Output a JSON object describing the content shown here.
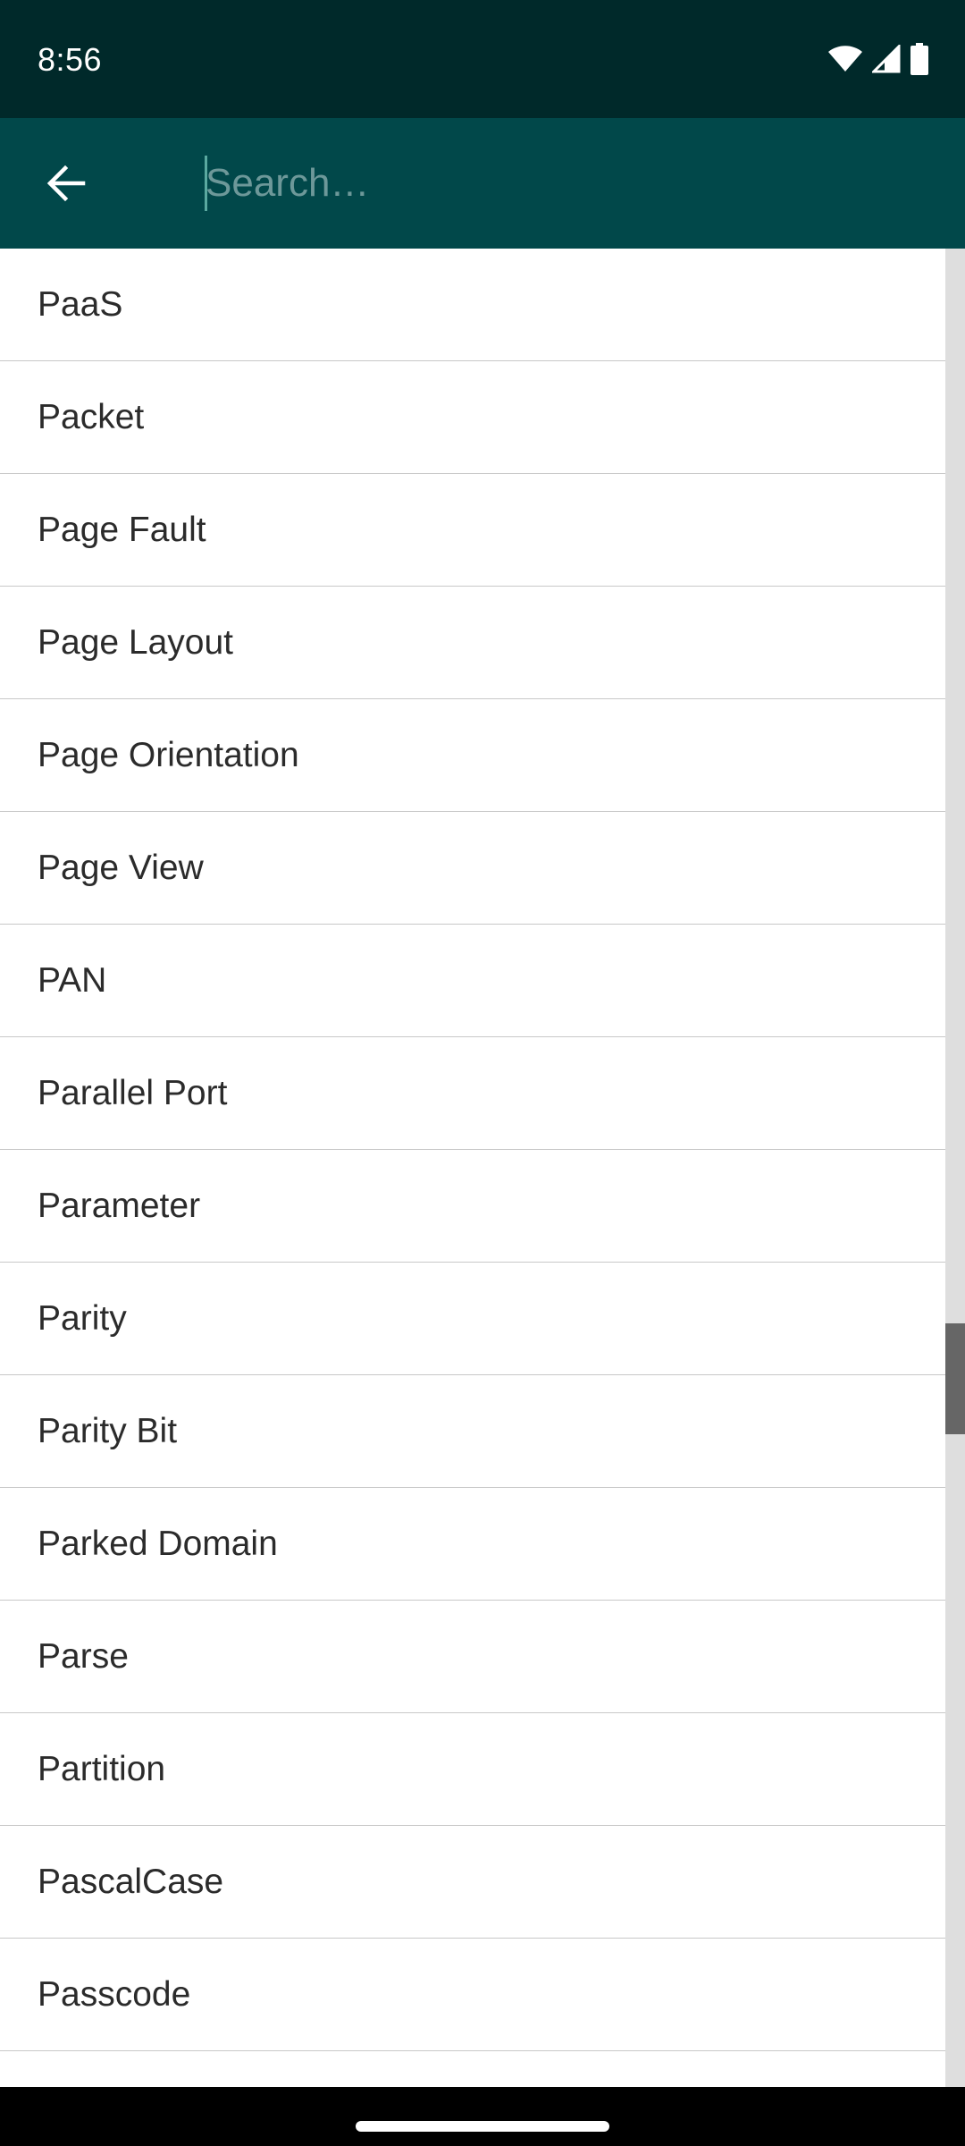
{
  "status_bar": {
    "time": "8:56",
    "icons": [
      "wifi-icon",
      "signal-icon",
      "battery-icon"
    ]
  },
  "app_bar": {
    "back_icon": "arrow-left-icon",
    "search": {
      "value": "",
      "placeholder": "Search…"
    }
  },
  "list": {
    "items": [
      {
        "label": "PaaS"
      },
      {
        "label": "Packet"
      },
      {
        "label": "Page Fault"
      },
      {
        "label": "Page Layout"
      },
      {
        "label": "Page Orientation"
      },
      {
        "label": "Page View"
      },
      {
        "label": "PAN"
      },
      {
        "label": "Parallel Port"
      },
      {
        "label": "Parameter"
      },
      {
        "label": "Parity"
      },
      {
        "label": "Parity Bit"
      },
      {
        "label": "Parked Domain"
      },
      {
        "label": "Parse"
      },
      {
        "label": "Partition"
      },
      {
        "label": "PascalCase"
      },
      {
        "label": "Passcode"
      },
      {
        "label": ""
      }
    ]
  },
  "colors": {
    "status_bar": "#00292a",
    "app_bar": "#01484a",
    "text": "#2b2b2b",
    "divider": "#c8c8c8"
  }
}
